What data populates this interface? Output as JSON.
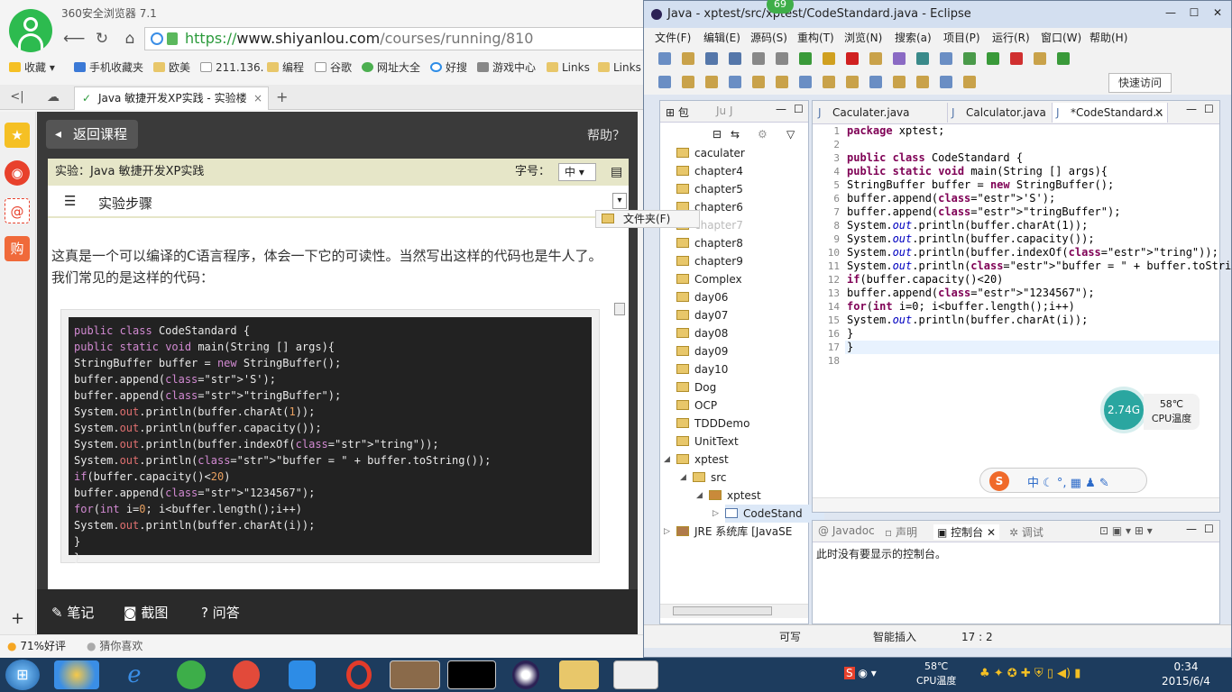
{
  "browser": {
    "title": "360安全浏览器 7.1",
    "url_scheme": "https://",
    "url_domain": "www.shiyanlou.com",
    "url_path": "/courses/running/810",
    "bookmarks": [
      "收藏",
      "手机收藏夹",
      "欧美",
      "211.136.",
      "编程",
      "谷歌",
      "网址大全",
      "好搜",
      "游戏中心",
      "Links",
      "Links"
    ],
    "tab_title": "Java 敏捷开发XP实践 - 实验楼",
    "tab_close": "×",
    "new_tab": "+",
    "status_left": "71%好评",
    "status_right": "猜你喜欢"
  },
  "page": {
    "back_label": "返回课程",
    "help_label": "帮助？",
    "experiment_title": "实验：Java 敏捷开发XP实践",
    "font_label": "字号：",
    "font_value": "中",
    "steps_label": "实验步骤",
    "paragraph": "这真是一个可以编译的C语言程序，体会一下它的可读性。当然写出这样的代码也是牛人了。我们常见的是这样的代码：",
    "bottom": {
      "notes": "笔记",
      "screenshot": "截图",
      "qa": "问答"
    },
    "code_lines": [
      "public class CodeStandard {",
      "public static void main(String [] args){",
      "StringBuffer buffer = new StringBuffer();",
      "buffer.append('S');",
      "buffer.append(\"tringBuffer\");",
      "System.out.println(buffer.charAt(1));",
      "System.out.println(buffer.capacity());",
      "System.out.println(buffer.indexOf(\"tring\"));",
      "System.out.println(\"buffer = \" + buffer.toString());",
      "if(buffer.capacity()<20)",
      "buffer.append(\"1234567\");",
      "for(int i=0; i<buffer.length();i++)",
      "System.out.println(buffer.charAt(i));",
      "}",
      "}"
    ]
  },
  "eclipse": {
    "title": "Java - xptest/src/xptest/CodeStandard.java - Eclipse",
    "badge": "69",
    "menu": [
      "文件(F)",
      "编辑(E)",
      "源码(S)",
      "重构(T)",
      "浏览(N)",
      "搜索(a)",
      "项目(P)",
      "运行(R)",
      "窗口(W)",
      "帮助(H)"
    ],
    "quick_access": "快速访问",
    "package_tab": "包",
    "junit_tab": "Ju J",
    "folder_tooltip": "文件夹(F)",
    "tree": [
      "caculater",
      "chapter4",
      "chapter5",
      "chapter6",
      "chapter7",
      "chapter8",
      "chapter9",
      "Complex",
      "day06",
      "day07",
      "day08",
      "day09",
      "day10",
      "Dog",
      "OCP",
      "TDDDemo",
      "UnitText",
      "xptest",
      "src",
      "xptest",
      "CodeStand",
      "JRE 系统库 [JavaSE"
    ],
    "editor_tabs": [
      "Caculater.java",
      "Calculator.java",
      "*CodeStandard..."
    ],
    "line_numbers": [
      "1",
      "2",
      "3",
      "4",
      "5",
      "6",
      "7",
      "8",
      "9",
      "10",
      "11",
      "12",
      "13",
      "14",
      "15",
      "16",
      "17",
      "18"
    ],
    "code": [
      "package xptest;",
      "",
      "public class CodeStandard {",
      "public static void main(String [] args){",
      "StringBuffer buffer = new StringBuffer();",
      "buffer.append('S');",
      "buffer.append(\"tringBuffer\");",
      "System.out.println(buffer.charAt(1));",
      "System.out.println(buffer.capacity());",
      "System.out.println(buffer.indexOf(\"tring\"));",
      "System.out.println(\"buffer = \" + buffer.toString());",
      "if(buffer.capacity()<20)",
      "buffer.append(\"1234567\");",
      "for(int i=0; i<buffer.length();i++)",
      "System.out.println(buffer.charAt(i));",
      "}",
      "}",
      ""
    ],
    "console_tabs": [
      "Javadoc",
      "声明",
      "控制台",
      "调试"
    ],
    "console_msg": "此时没有要显示的控制台。",
    "status": {
      "writable": "可写",
      "insert": "智能插入",
      "pos": "17 : 2"
    },
    "cpu": {
      "freq": "2.74G",
      "temp": "58℃",
      "label": "CPU温度"
    }
  },
  "taskbar": {
    "temp": "58℃",
    "temp_label": "CPU温度",
    "time": "0:34",
    "date": "2015/6/4"
  }
}
